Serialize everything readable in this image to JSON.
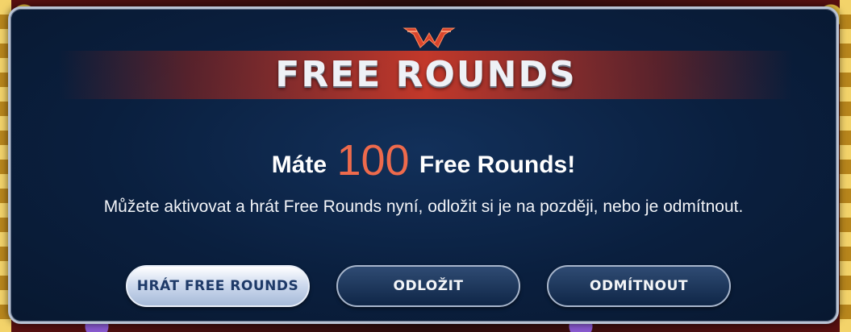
{
  "dialog": {
    "title": "FREE ROUNDS",
    "headline_prefix": "Máte",
    "headline_count": "100",
    "headline_suffix": "Free Rounds!",
    "message": "Můžete aktivovat a hrát Free Rounds nyní, odložit si je na později, nebo je odmítnout.",
    "buttons": {
      "play": "HRÁT FREE ROUNDS",
      "later": "ODLOŽIT",
      "decline": "ODMÍTNOUT"
    },
    "logo_icon": "crown-wings-icon"
  },
  "colors": {
    "panel": "#0a1f3e",
    "title_band": "#c2382a",
    "count_accent": "#ee6a4c",
    "border": "#b9c3d4"
  }
}
